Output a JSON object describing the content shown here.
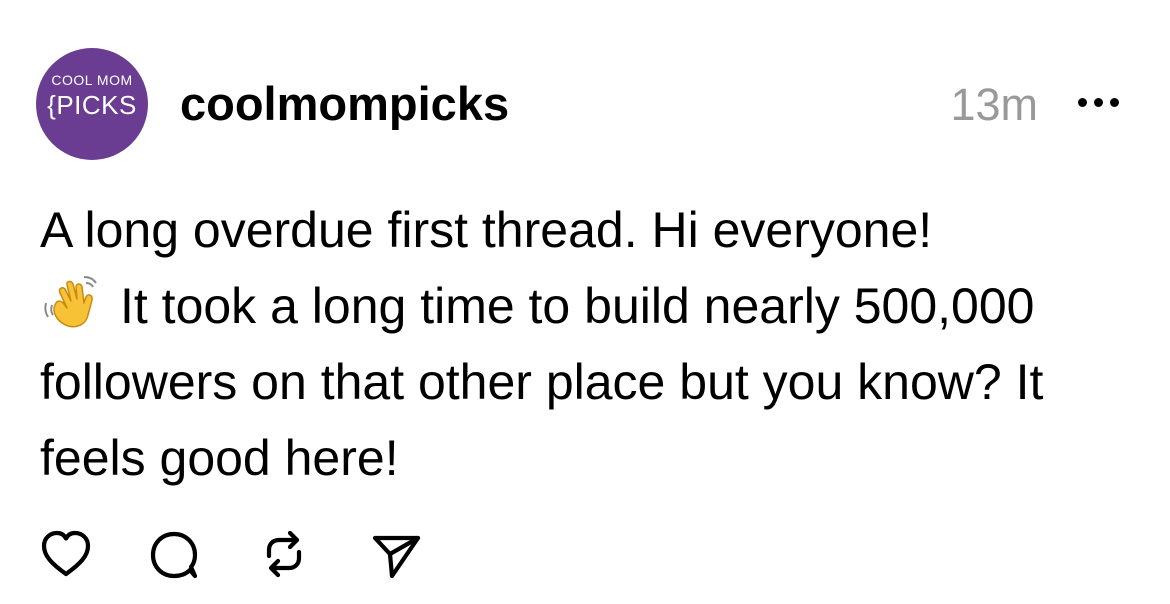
{
  "post": {
    "avatar": {
      "line1": "COOL MOM",
      "line2": "{PICKS",
      "bg_color": "#6a3d92"
    },
    "username": "coolmompicks",
    "timestamp": "13m",
    "more_icon": "more-horizontal-icon",
    "text_before_emoji": "A long overdue first thread. Hi everyone!",
    "emoji": "waving-hand-emoji",
    "text_after_emoji": "It took a long time to build nearly 500,000 followers on that other place but you know? It feels good here!",
    "actions": [
      {
        "name": "like",
        "icon": "heart-icon"
      },
      {
        "name": "reply",
        "icon": "comment-icon"
      },
      {
        "name": "repost",
        "icon": "repost-icon"
      },
      {
        "name": "share",
        "icon": "send-icon"
      }
    ]
  }
}
